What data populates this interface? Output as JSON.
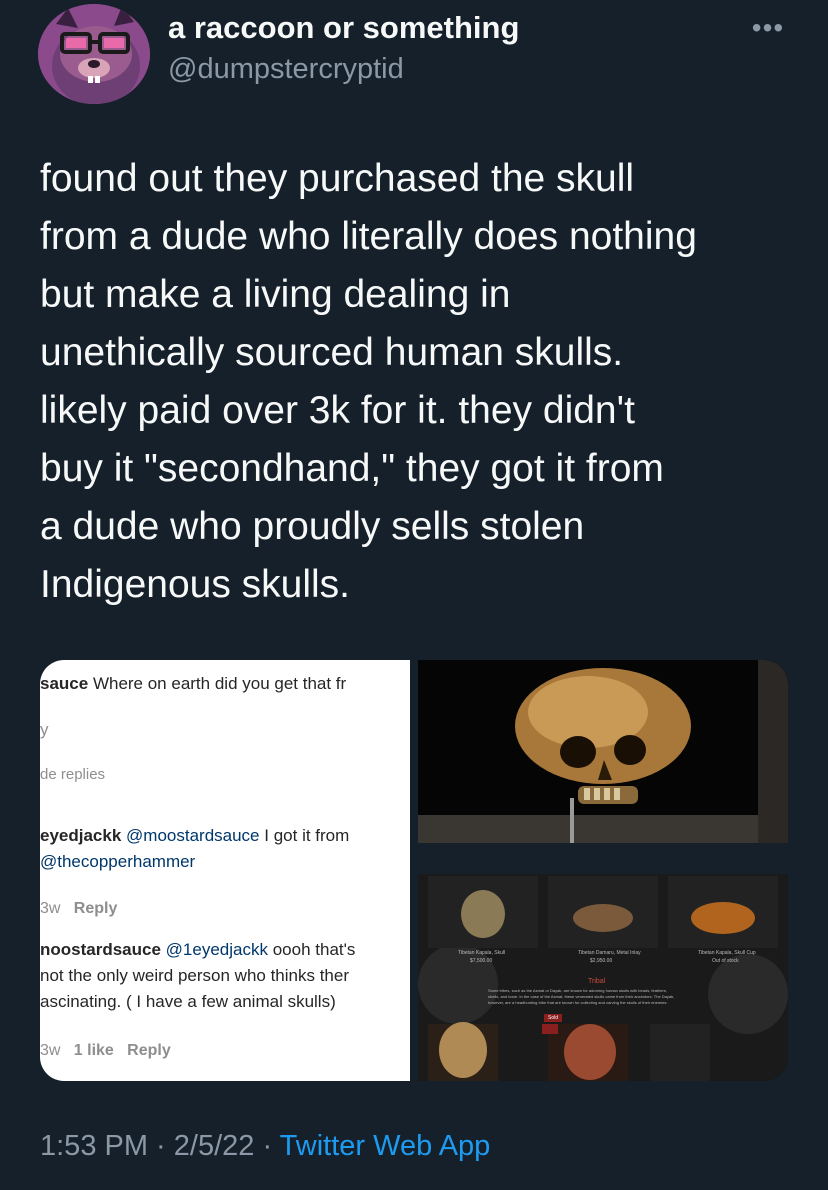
{
  "header": {
    "display_name": "a raccoon or something",
    "handle": "@dumpstercryptid",
    "more_icon": "more-options-icon",
    "more_glyph": "•••"
  },
  "tweet": {
    "text": "found out they purchased the skull\nfrom a dude who literally does nothing\nbut make a living dealing in\nunethically sourced human skulls.\nlikely paid over 3k for it. they didn't\nbuy it \"secondhand,\" they got it from\na dude who proudly sells stolen\nIndigenous skulls."
  },
  "media": {
    "comments": {
      "c1_user": "sauce",
      "c1_text": "Where on earth did you get that fr",
      "c1_meta": "y",
      "hide_replies": "de replies",
      "c2_user": "eyedjackk",
      "c2_mention": "@moostardsauce",
      "c2_text": "I got it from",
      "c2_mention2": "@thecopperhammer",
      "c2_time": "3w",
      "c2_reply": "Reply",
      "c3_user": "noostardsauce",
      "c3_mention": "@1eyedjackk",
      "c3_text1": "oooh that's",
      "c3_text2": "not the only weird person who thinks ther",
      "c3_text3": "ascinating. ( I have a few animal skulls)",
      "c3_time": "3w",
      "c3_likes": "1 like",
      "c3_reply": "Reply"
    },
    "shop": {
      "item1": "Tibetan Kapala, Skull",
      "item1_price": "$7,500.00",
      "item2": "Tibetan Damaru, Metal Inlay",
      "item2_price": "$2,950.00",
      "item3": "Tibetan Kapala, Skull Cup",
      "item3_status": "Out of stock",
      "section_title": "Tribal",
      "section_desc1": "Some tribes, such as the Asmat or Dayak, are known for adorning human skulls with beads, feathers,",
      "section_desc2": "shells, and bone. In the case of the Asmat, these venerated skulls came from their ancestors. The Dayak,",
      "section_desc3": "however, are a headhunting tribe that are known for collecting and carving the skulls of their enemies.",
      "sold_badge": "Sold"
    }
  },
  "meta": {
    "time": "1:53 PM",
    "sep1": " · ",
    "date": "2/5/22",
    "sep2": " · ",
    "source": "Twitter Web App"
  },
  "colors": {
    "background": "#15202b",
    "text": "#f7f9f9",
    "secondary": "#8b98a5",
    "accent": "#1d9bf0"
  }
}
